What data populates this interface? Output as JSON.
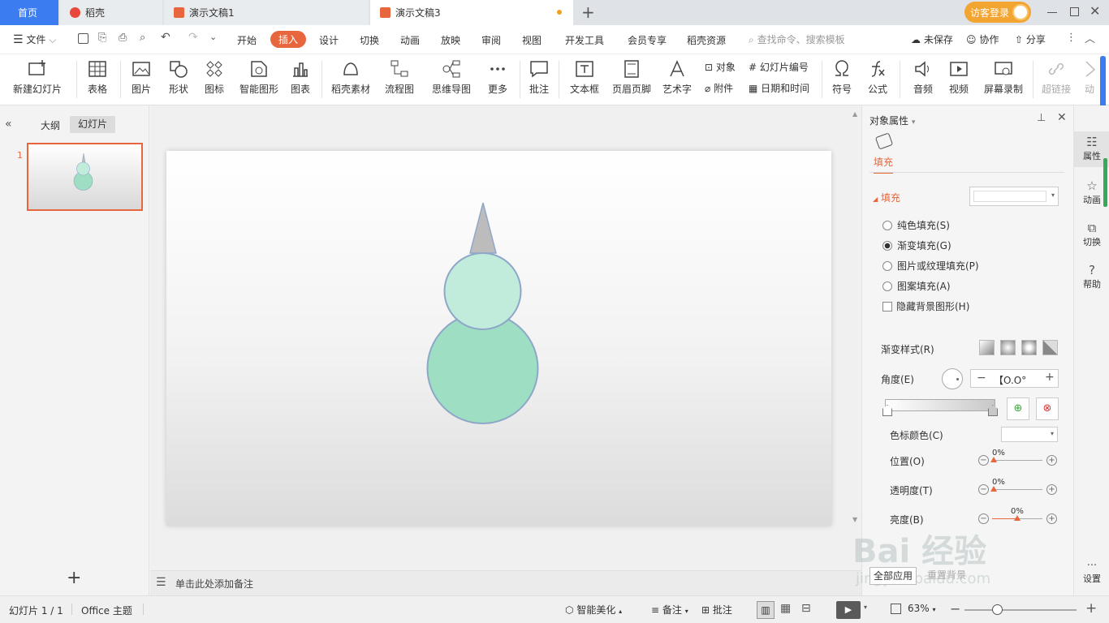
{
  "tabs": {
    "home": "首页",
    "daoke": "稻壳",
    "doc1": "演示文稿1",
    "doc3": "演示文稿3",
    "add": "+",
    "login": "访客登录"
  },
  "menu": {
    "file": "文件",
    "items": [
      "开始",
      "插入",
      "设计",
      "切换",
      "动画",
      "放映",
      "审阅",
      "视图",
      "开发工具",
      "会员专享",
      "稻壳资源"
    ],
    "search_placeholder": "查找命令、搜索模板",
    "unsaved": "未保存",
    "collab": "协作",
    "share": "分享"
  },
  "ribbon": {
    "new_slide": "新建幻灯片",
    "table": "表格",
    "picture": "图片",
    "shape": "形状",
    "icon": "图标",
    "smart": "智能图形",
    "chart": "图表",
    "material": "稻壳素材",
    "flow": "流程图",
    "mindmap": "思维导图",
    "more": "更多",
    "comment": "批注",
    "textbox": "文本框",
    "headerfooter": "页眉页脚",
    "wordart": "艺术字",
    "object": "对象",
    "attach": "附件",
    "slidenum": "幻灯片编号",
    "datetime": "日期和时间",
    "symbol": "符号",
    "formula": "公式",
    "audio": "音频",
    "video": "视频",
    "record": "屏幕录制",
    "hyperlink": "超链接",
    "anim": "动"
  },
  "left": {
    "outline": "大纲",
    "slides": "幻灯片",
    "slide_num": "1",
    "add": "+"
  },
  "notes": {
    "placeholder": "单击此处添加备注"
  },
  "panel": {
    "title": "对象属性",
    "tab_fill": "填充",
    "section_fill": "填充",
    "solid": "纯色填充(S)",
    "gradient": "渐变填充(G)",
    "picture": "图片或纹理填充(P)",
    "pattern": "图案填充(A)",
    "hide_bg": "隐藏背景图形(H)",
    "grad_style": "渐变样式(R)",
    "angle": "角度(E)",
    "angle_value": "【O.O°",
    "stop_color": "色标颜色(C)",
    "position": "位置(O)",
    "transparency": "透明度(T)",
    "brightness": "亮度(B)",
    "pos_value": "0%",
    "trans_value": "0%",
    "bright_value": "0%",
    "apply_all": "全部应用",
    "reset_bg": "重置背景",
    "watermark_top": "Bai 经验",
    "watermark_bottom": "jingyan.baidu.com"
  },
  "sidebar": {
    "props": "属性",
    "anim": "动画",
    "trans": "切换",
    "help": "帮助",
    "settings": "设置"
  },
  "status": {
    "slide_info": "幻灯片 1 / 1",
    "theme": "Office 主题",
    "beautify": "智能美化",
    "notes": "备注",
    "comment": "批注",
    "zoom": "63%"
  },
  "colors": {
    "accent": "#e8663d",
    "circle_small": "#c1ecdc",
    "circle_big": "#9edfc3",
    "stroke": "#8ea7c8",
    "cone": "#bcbcbc"
  }
}
